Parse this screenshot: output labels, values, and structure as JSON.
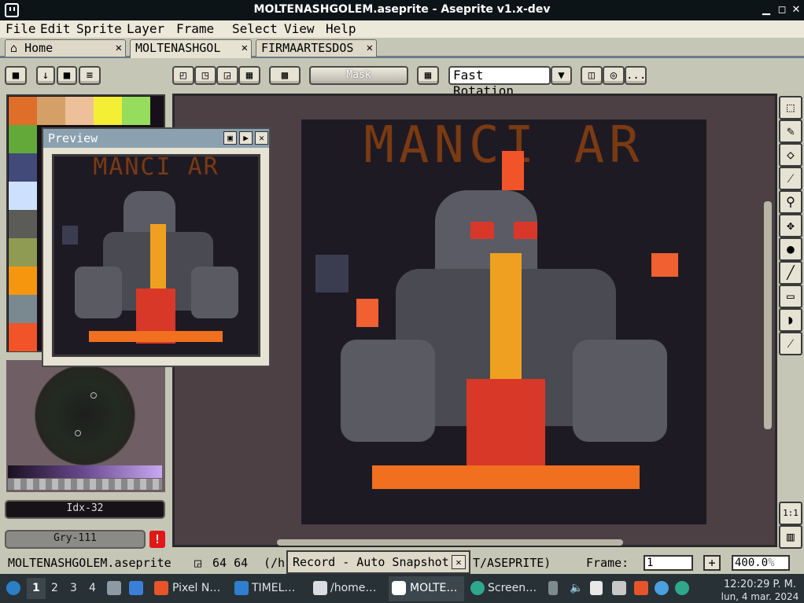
{
  "window": {
    "title": "MOLTENASHGOLEM.aseprite - Aseprite v1.x-dev",
    "buttons": [
      "▁",
      "◻",
      "✕"
    ]
  },
  "menu": [
    "File",
    "Edit",
    "Sprite",
    "Layer",
    "Frame",
    "Select",
    "View",
    "Help"
  ],
  "tabs": [
    {
      "label": "Home",
      "close": "✕"
    },
    {
      "label": "MOLTENASHGOL",
      "close": "✕"
    },
    {
      "label": "FIRMAARTESDOS",
      "close": "✕"
    }
  ],
  "toolbar": {
    "mask_label": "Mask",
    "rotation_value": "Fast Rotation",
    "dropdown_arrow": "▼",
    "more_label": "..."
  },
  "palette": {
    "colors": [
      "#de6e2a",
      "#d5a067",
      "#edc09a",
      "#f4ee34",
      "#96dd5e",
      "#63a93a",
      "#414a78",
      "#cde1ff",
      "#5b5b58",
      "#8f9a52",
      "#f6960e",
      "#7a8890",
      "#f05428"
    ]
  },
  "color_fields": {
    "index": "Idx-32",
    "grey": "Gry-111",
    "warning": "!"
  },
  "preview": {
    "title": "Preview"
  },
  "art": {
    "title": "MANCI AR"
  },
  "status": {
    "filename": "MOLTENASHGOLEM.aseprite",
    "size": "64 64",
    "path_start": "(/h",
    "path_end": "T/ASEPRITE)",
    "frame_label": "Frame:",
    "frame_value": "1",
    "plus": "+",
    "zoom": "400.0",
    "zoom_unit": "%"
  },
  "record": {
    "label": "Record - Auto Snapshot",
    "close": "✕"
  },
  "tools_bottom": {
    "one_to_one": "1:1"
  },
  "taskbar": {
    "workspaces": [
      "1",
      "2",
      "3",
      "4"
    ],
    "apps": [
      "Pixel N…",
      "TIMEL…",
      "/home…",
      "MOLTE…",
      "Screen…"
    ],
    "time": "12:20:29 P. M.",
    "date": "lun, 4 mar. 2024"
  }
}
